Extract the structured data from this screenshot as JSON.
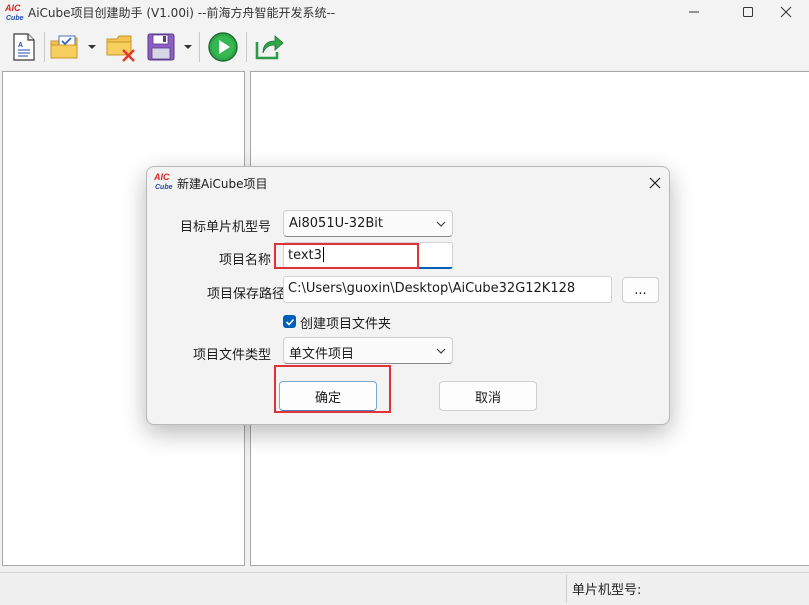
{
  "window": {
    "title": "AiCube项目创建助手 (V1.00i) --前海方舟智能开发系统--",
    "logo_text": "AiCube"
  },
  "toolbar": {
    "buttons": [
      {
        "name": "new-document",
        "icon": "document-icon"
      },
      {
        "name": "open-folder",
        "icon": "folder-check-icon",
        "has_dropdown": true
      },
      {
        "name": "close-project",
        "icon": "folder-delete-icon"
      },
      {
        "name": "save",
        "icon": "floppy-disk-icon",
        "has_dropdown": true
      },
      {
        "name": "run",
        "icon": "play-icon"
      },
      {
        "name": "export",
        "icon": "export-arrow-icon"
      }
    ]
  },
  "statusbar": {
    "mcu_label": "单片机型号:"
  },
  "dialog": {
    "title": "新建AiCube项目",
    "mcu_model_label": "目标单片机型号",
    "mcu_model_value": "Ai8051U-32Bit",
    "project_name_label": "项目名称",
    "project_name_value": "text3",
    "project_path_label": "项目保存路径",
    "project_path_value": "C:\\Users\\guoxin\\Desktop\\AiCube32G12K128",
    "browse_label": "...",
    "create_folder_label": "创建项目文件夹",
    "create_folder_checked": true,
    "file_type_label": "项目文件类型",
    "file_type_value": "单文件项目",
    "ok_label": "确定",
    "cancel_label": "取消"
  },
  "colors": {
    "accent": "#005fb8",
    "highlight": "#e1323c",
    "logo_red": "#d42a2a",
    "logo_blue": "#1f4aa8"
  }
}
